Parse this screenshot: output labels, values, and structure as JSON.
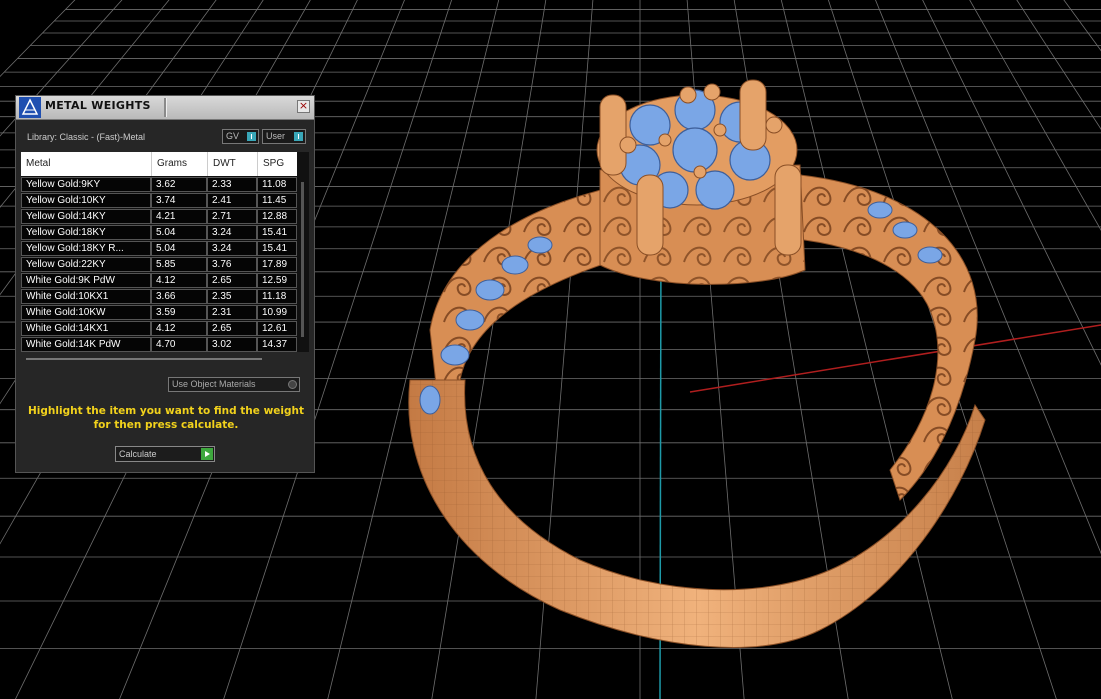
{
  "panel": {
    "title": "METAL WEIGHTS",
    "library_label": "Library: Classic - (Fast)-Metal",
    "toggles": [
      "GV",
      "User"
    ],
    "columns": [
      "Metal",
      "Grams",
      "DWT",
      "SPG"
    ],
    "rows": [
      [
        "Yellow Gold:9KY",
        "3.62",
        "2.33",
        "11.08"
      ],
      [
        "Yellow Gold:10KY",
        "3.74",
        "2.41",
        "11.45"
      ],
      [
        "Yellow Gold:14KY",
        "4.21",
        "2.71",
        "12.88"
      ],
      [
        "Yellow Gold:18KY",
        "5.04",
        "3.24",
        "15.41"
      ],
      [
        "Yellow Gold:18KY R...",
        "5.04",
        "3.24",
        "15.41"
      ],
      [
        "Yellow Gold:22KY",
        "5.85",
        "3.76",
        "17.89"
      ],
      [
        "White Gold:9K PdW",
        "4.12",
        "2.65",
        "12.59"
      ],
      [
        "White Gold:10KX1",
        "3.66",
        "2.35",
        "11.18"
      ],
      [
        "White Gold:10KW",
        "3.59",
        "2.31",
        "10.99"
      ],
      [
        "White Gold:14KX1",
        "4.12",
        "2.65",
        "12.61"
      ],
      [
        "White Gold:14K PdW",
        "4.70",
        "3.02",
        "14.37"
      ]
    ],
    "use_object_materials": "Use Object Materials",
    "instructions_line1": "Highlight the item you want to find the weight",
    "instructions_line2": "for then press calculate.",
    "calculate_label": "Calculate"
  },
  "colors": {
    "metal": "#e09a5f",
    "gem": "#7aa6e6",
    "grid": "#6e6e6e",
    "axis_x": "#b01e1e",
    "axis_y": "#1e9aa8",
    "highlight_text": "#f2d21c"
  }
}
